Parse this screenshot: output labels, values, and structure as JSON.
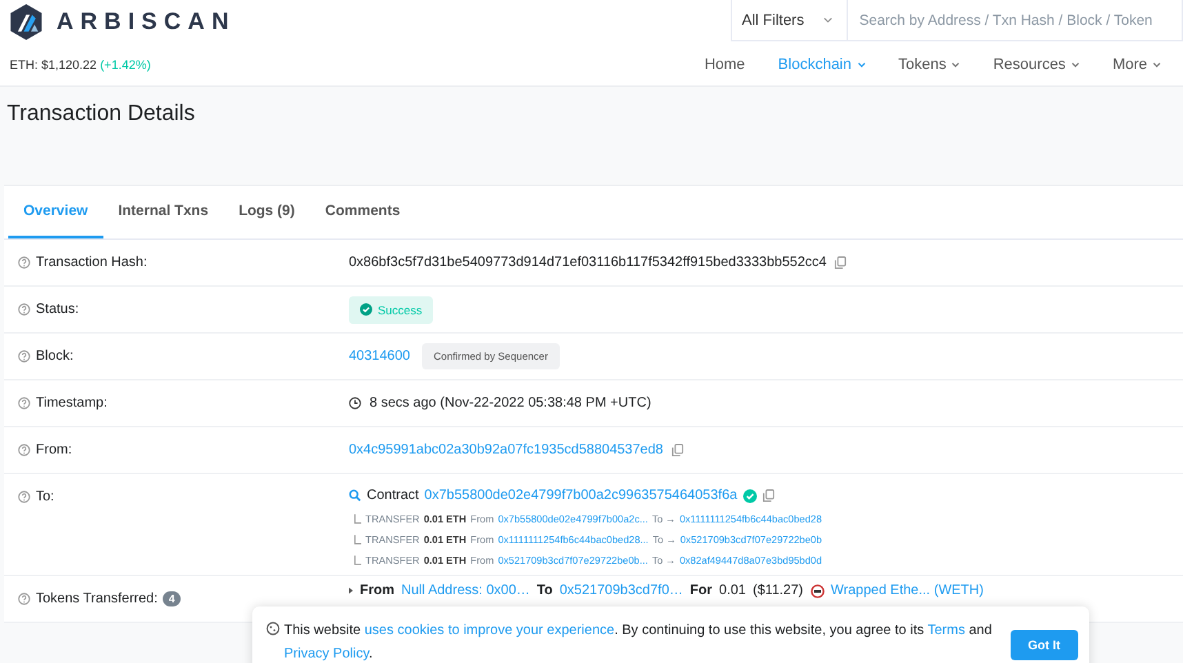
{
  "header": {
    "logo_text": "ARBISCAN",
    "eth_price": "ETH: $1,120.22",
    "eth_change": "(+1.42%)",
    "filter": "All Filters",
    "search": {
      "placeholder": "Search by Address / Txn Hash / Block / Token"
    },
    "nav": [
      {
        "label": "Home",
        "selected": false,
        "dropdown": false
      },
      {
        "label": "Blockchain",
        "selected": true,
        "dropdown": true
      },
      {
        "label": "Tokens",
        "selected": false,
        "dropdown": true
      },
      {
        "label": "Resources",
        "selected": false,
        "dropdown": true
      },
      {
        "label": "More",
        "selected": false,
        "dropdown": true
      }
    ]
  },
  "page_title": "Transaction Details",
  "tabs": [
    {
      "label": "Overview",
      "selected": true
    },
    {
      "label": "Internal Txns",
      "selected": false
    },
    {
      "label": "Logs (9)",
      "selected": false
    },
    {
      "label": "Comments",
      "selected": false
    }
  ],
  "rows": [
    {
      "kind": "hash",
      "label": "Transaction Hash:",
      "value": "0x86bf3c5f7d31be5409773d914d71ef03116b117f5342ff915bed3333bb552cc4"
    },
    {
      "kind": "status",
      "label": "Status:",
      "value": "Success"
    },
    {
      "kind": "block",
      "label": "Block:",
      "value": "40314600",
      "note": "Confirmed by Sequencer"
    },
    {
      "kind": "timestamp",
      "label": "Timestamp:",
      "value": "8 secs ago (Nov-22-2022 05:38:48 PM +UTC)"
    },
    {
      "kind": "address",
      "label": "From:",
      "value": "0x4c95991abc02a30b92a07fc1935cd58804537ed8"
    },
    {
      "kind": "contract",
      "label": "To:",
      "prefix": "Contract",
      "value": "0x7b55800de02e4799f7b00a2c9963575464053f6a",
      "verified": true,
      "transfers": [
        {
          "type": "TRANSFER",
          "amount": "0.01 ETH",
          "from_label": "From",
          "from": "0x7b55800de02e4799f7b00a2c...",
          "to_label": "To →",
          "to": "0x1111111254fb6c44bac0bed28"
        },
        {
          "type": "TRANSFER",
          "amount": "0.01 ETH",
          "from_label": "From",
          "from": "0x1111111254fb6c44bac0bed28...",
          "to_label": "To →",
          "to": "0x521709b3cd7f07e29722be0b"
        },
        {
          "type": "TRANSFER",
          "amount": "0.01 ETH",
          "from_label": "From",
          "from": "0x521709b3cd7f07e29722be0b...",
          "to_label": "To →",
          "to": "0x82af49447d8a07e3bd95bd0d"
        }
      ]
    },
    {
      "kind": "tokens",
      "label": "Tokens Transferred:",
      "count": "4",
      "from_label": "From",
      "from": "Null Address: 0x00…",
      "to_label": "To",
      "to": "0x521709b3cd7f0…",
      "for_label": "For",
      "amount": "0.01",
      "usd": "($11.27)",
      "token": "Wrapped Ethe... (WETH)"
    }
  ],
  "cookie": {
    "text_1": "This website ",
    "link_1": "uses cookies to improve your experience",
    "text_2": ". By continuing to use this website, you agree to its ",
    "link_2": "Terms",
    "text_3": " and ",
    "link_3": "Privacy Policy",
    "text_4": ".",
    "button": "Got It"
  }
}
